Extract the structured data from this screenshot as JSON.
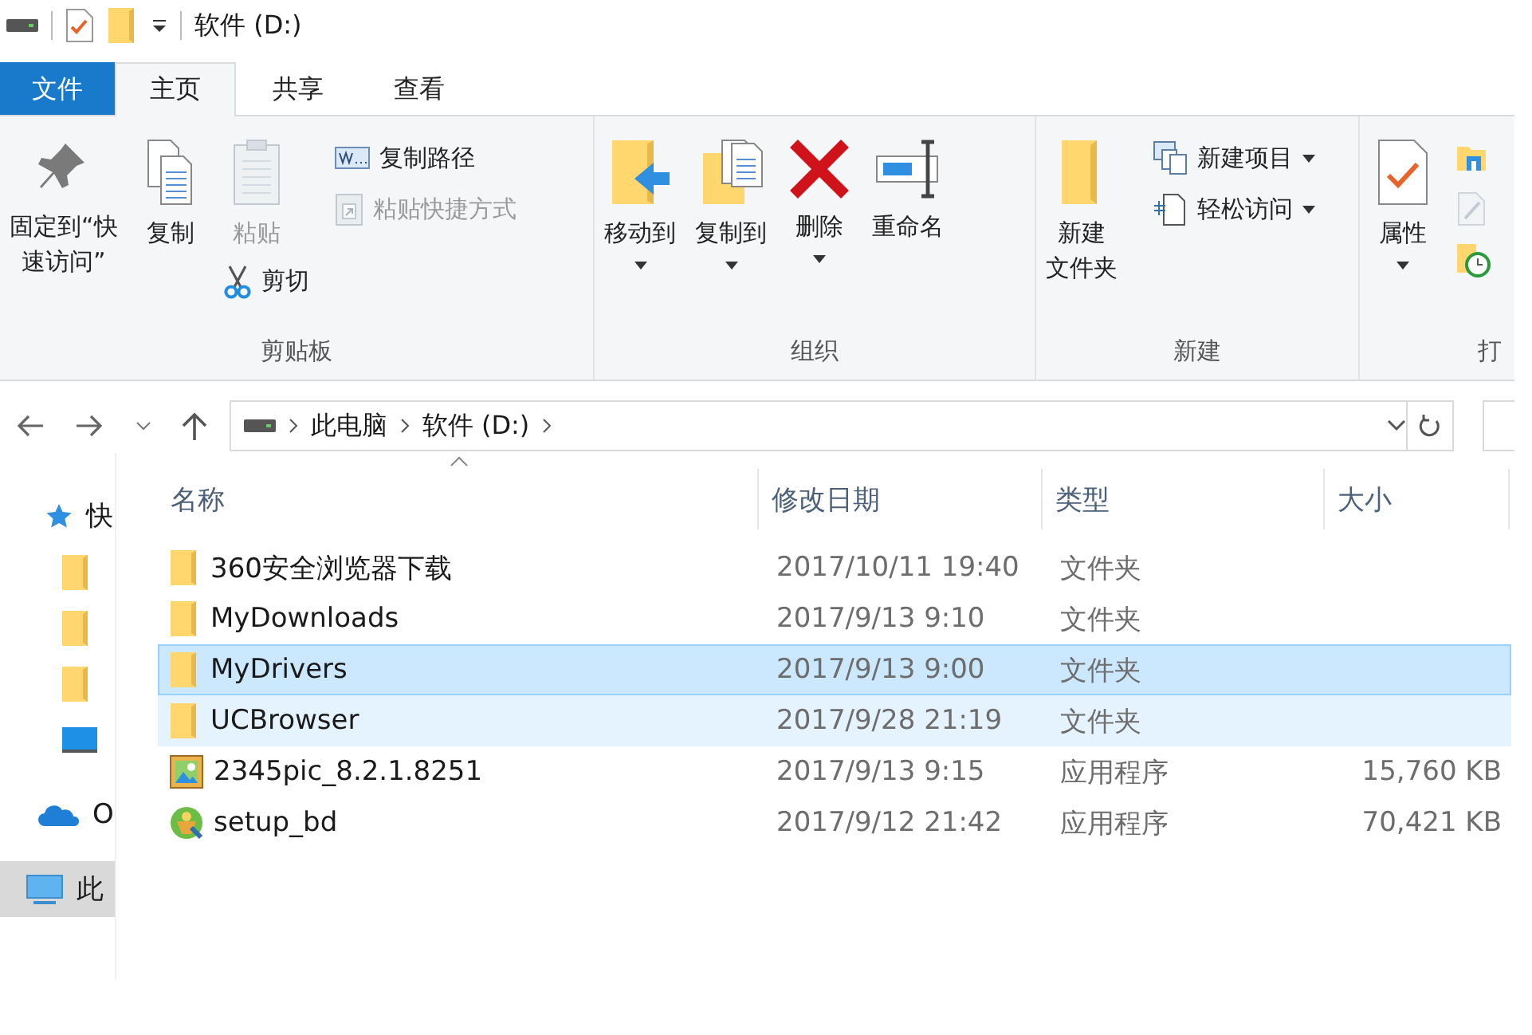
{
  "title_bar": {
    "title": "软件 (D:)"
  },
  "tabs": [
    {
      "label": "文件",
      "kind": "file",
      "selected": false
    },
    {
      "label": "主页",
      "kind": "tab",
      "selected": true
    },
    {
      "label": "共享",
      "kind": "tab",
      "selected": false
    },
    {
      "label": "查看",
      "kind": "tab",
      "selected": false
    }
  ],
  "ribbon": {
    "groups": [
      {
        "label": "剪贴板",
        "columns": [
          [
            {
              "kind": "large",
              "lines": [
                "固定到“快",
                "速访问”"
              ],
              "disabled": false,
              "dropdown": false
            }
          ],
          [
            {
              "kind": "large",
              "label": "复制",
              "disabled": false,
              "dropdown": false
            }
          ],
          [
            {
              "kind": "large",
              "label": "粘贴",
              "disabled": true,
              "dropdown": false
            },
            {
              "kind": "small",
              "label": "剪切",
              "disabled": false,
              "dropdown": false
            }
          ],
          [
            {
              "kind": "small",
              "label": "复制路径",
              "disabled": false,
              "dropdown": false
            },
            {
              "kind": "small",
              "label": "粘贴快捷方式",
              "disabled": true,
              "dropdown": false
            }
          ]
        ]
      },
      {
        "label": "组织",
        "columns": [
          [
            {
              "kind": "large",
              "label": "移动到",
              "disabled": false,
              "dropdown": true
            }
          ],
          [
            {
              "kind": "large",
              "label": "复制到",
              "disabled": false,
              "dropdown": true
            }
          ],
          [
            {
              "kind": "large",
              "label": "删除",
              "disabled": false,
              "dropdown": true
            }
          ],
          [
            {
              "kind": "large",
              "label": "重命名",
              "disabled": false,
              "dropdown": false
            }
          ]
        ]
      },
      {
        "label": "新建",
        "columns": [
          [
            {
              "kind": "large",
              "lines": [
                "新建",
                "文件夹"
              ],
              "disabled": false,
              "dropdown": false
            }
          ],
          [
            {
              "kind": "small",
              "label": "新建项目",
              "disabled": false,
              "dropdown": true
            },
            {
              "kind": "small",
              "label": "轻松访问",
              "disabled": false,
              "dropdown": true
            }
          ]
        ]
      },
      {
        "label": "打",
        "columns": [
          [
            {
              "kind": "large",
              "label": "属性",
              "disabled": false,
              "dropdown": true
            }
          ],
          [
            {
              "kind": "small",
              "disabled": false,
              "dropdown": false
            },
            {
              "kind": "small",
              "disabled": true,
              "dropdown": false
            },
            {
              "kind": "small",
              "disabled": false,
              "dropdown": false
            }
          ]
        ]
      }
    ]
  },
  "address_bar": {
    "path": [
      "此电脑",
      "软件 (D:)"
    ]
  },
  "nav_pane": {
    "items": [
      {
        "kind": "quick",
        "label": "快",
        "selected": false
      },
      {
        "kind": "folder",
        "selected": false
      },
      {
        "kind": "folder",
        "selected": false
      },
      {
        "kind": "folder",
        "selected": false
      },
      {
        "kind": "desktop",
        "selected": false
      },
      {
        "kind": "onedrive",
        "label": "O",
        "selected": false
      },
      {
        "kind": "pc",
        "label": "此",
        "selected": true
      }
    ]
  },
  "file_list": {
    "columns": [
      {
        "label": "名称",
        "sorted": true
      },
      {
        "label": "修改日期",
        "sorted": false
      },
      {
        "label": "类型",
        "sorted": false
      },
      {
        "label": "大小",
        "sorted": false
      }
    ],
    "rows": [
      {
        "kind": "folder",
        "name": "360安全浏览器下载",
        "date": "2017/10/11 19:40",
        "type": "文件夹",
        "selected": false,
        "hovered": false
      },
      {
        "kind": "folder",
        "name": "MyDownloads",
        "date": "2017/9/13 9:10",
        "type": "文件夹",
        "selected": false,
        "hovered": false
      },
      {
        "kind": "folder",
        "name": "MyDrivers",
        "date": "2017/9/13 9:00",
        "type": "文件夹",
        "selected": true,
        "hovered": false
      },
      {
        "kind": "folder",
        "name": "UCBrowser",
        "date": "2017/9/28 21:19",
        "type": "文件夹",
        "selected": false,
        "hovered": true
      },
      {
        "kind": "image-app",
        "name": "2345pic_8.2.1.8251",
        "date": "2017/9/13 9:15",
        "type": "应用程序",
        "size": "15,760 KB",
        "selected": false,
        "hovered": false
      },
      {
        "kind": "installer",
        "name": "setup_bd",
        "date": "2017/9/12 21:42",
        "type": "应用程序",
        "size": "70,421 KB",
        "selected": false,
        "hovered": false
      }
    ]
  }
}
